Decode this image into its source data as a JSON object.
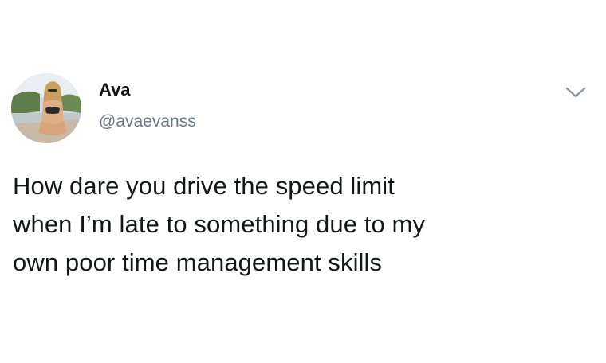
{
  "tweet": {
    "author": {
      "name": "Ava",
      "handle": "@avaevanss"
    },
    "text_lines": [
      "How dare you drive the speed limit",
      "when I’m late to something due to my",
      "own poor time management skills"
    ]
  },
  "icons": {
    "menu": "chevron-down-icon",
    "avatar": "profile-photo"
  },
  "colors": {
    "text": "#14171a",
    "secondary": "#657786",
    "background": "#ffffff"
  }
}
